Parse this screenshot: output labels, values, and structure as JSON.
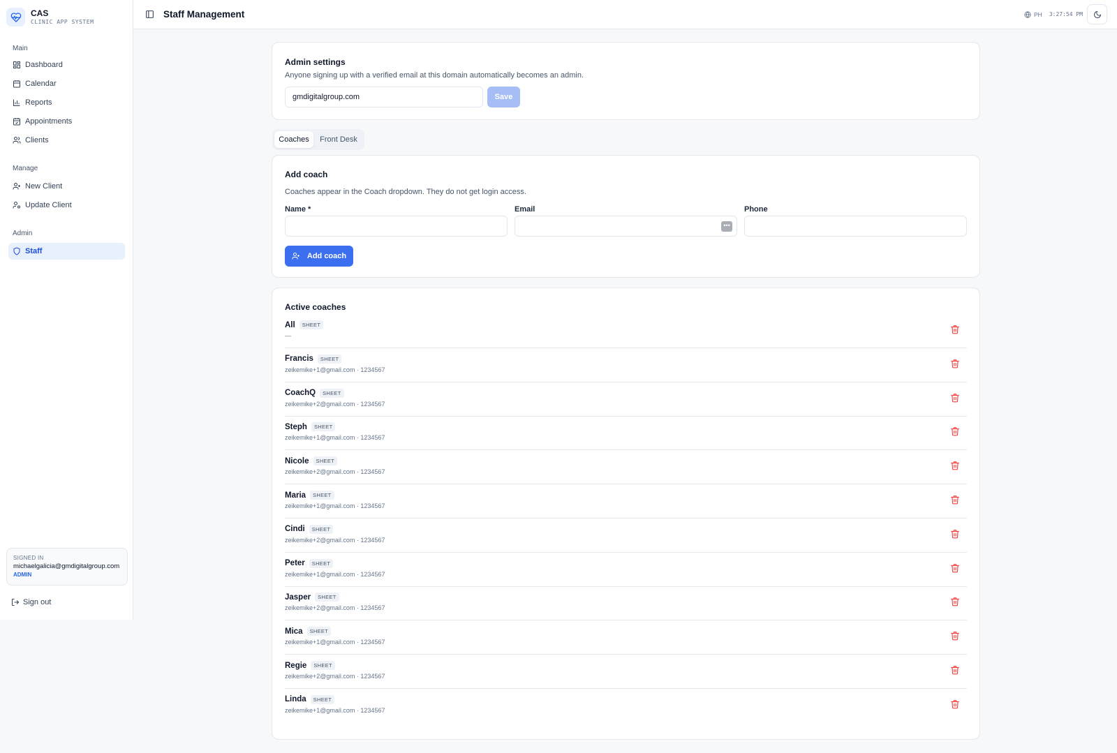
{
  "brand": {
    "title": "CAS",
    "subtitle": "CLINIC APP SYSTEM"
  },
  "sidebar": {
    "groups": [
      {
        "label": "Main",
        "items": [
          "Dashboard",
          "Calendar",
          "Reports",
          "Appointments",
          "Clients"
        ]
      },
      {
        "label": "Manage",
        "items": [
          "New Client",
          "Update Client"
        ]
      },
      {
        "label": "Admin",
        "items": [
          "Staff"
        ]
      }
    ],
    "active_item": "Staff"
  },
  "signed_in": {
    "label": "SIGNED IN",
    "email": "michaelgalicia@gmdigitalgroup.com",
    "role": "ADMIN"
  },
  "sign_out": "Sign out",
  "header": {
    "title": "Staff Management",
    "timezone": "PH",
    "time": "3:27:54 PM"
  },
  "admin_settings": {
    "title": "Admin settings",
    "description": "Anyone signing up with a verified email at this domain automatically becomes an admin.",
    "domain_value": "gmdigitalgroup.com",
    "save_label": "Save"
  },
  "tabs": [
    {
      "label": "Coaches",
      "active": true
    },
    {
      "label": "Front Desk",
      "active": false
    }
  ],
  "add_coach": {
    "title": "Add coach",
    "description": "Coaches appear in the Coach dropdown. They do not get login access.",
    "name_label": "Name *",
    "email_label": "Email",
    "phone_label": "Phone",
    "button_label": "Add coach"
  },
  "active_coaches": {
    "title": "Active coaches",
    "badge": "SHEET",
    "rows": [
      {
        "name": "All",
        "sub": "—"
      },
      {
        "name": "Francis",
        "sub": "zeikemike+1@gmail.com · 1234567"
      },
      {
        "name": "CoachQ",
        "sub": "zeikemike+2@gmail.com · 1234567"
      },
      {
        "name": "Steph",
        "sub": "zeikemike+1@gmail.com · 1234567"
      },
      {
        "name": "Nicole",
        "sub": "zeikemike+2@gmail.com · 1234567"
      },
      {
        "name": "Maria",
        "sub": "zeikemike+1@gmail.com · 1234567"
      },
      {
        "name": "Cindi",
        "sub": "zeikemike+2@gmail.com · 1234567"
      },
      {
        "name": "Peter",
        "sub": "zeikemike+1@gmail.com · 1234567"
      },
      {
        "name": "Jasper",
        "sub": "zeikemike+2@gmail.com · 1234567"
      },
      {
        "name": "Mica",
        "sub": "zeikemike+1@gmail.com · 1234567"
      },
      {
        "name": "Regie",
        "sub": "zeikemike+2@gmail.com · 1234567"
      },
      {
        "name": "Linda",
        "sub": "zeikemike+1@gmail.com · 1234567"
      }
    ]
  },
  "colors": {
    "accent": "#3b6ff0",
    "danger": "#ef4444",
    "active_bg": "#e8effd"
  }
}
